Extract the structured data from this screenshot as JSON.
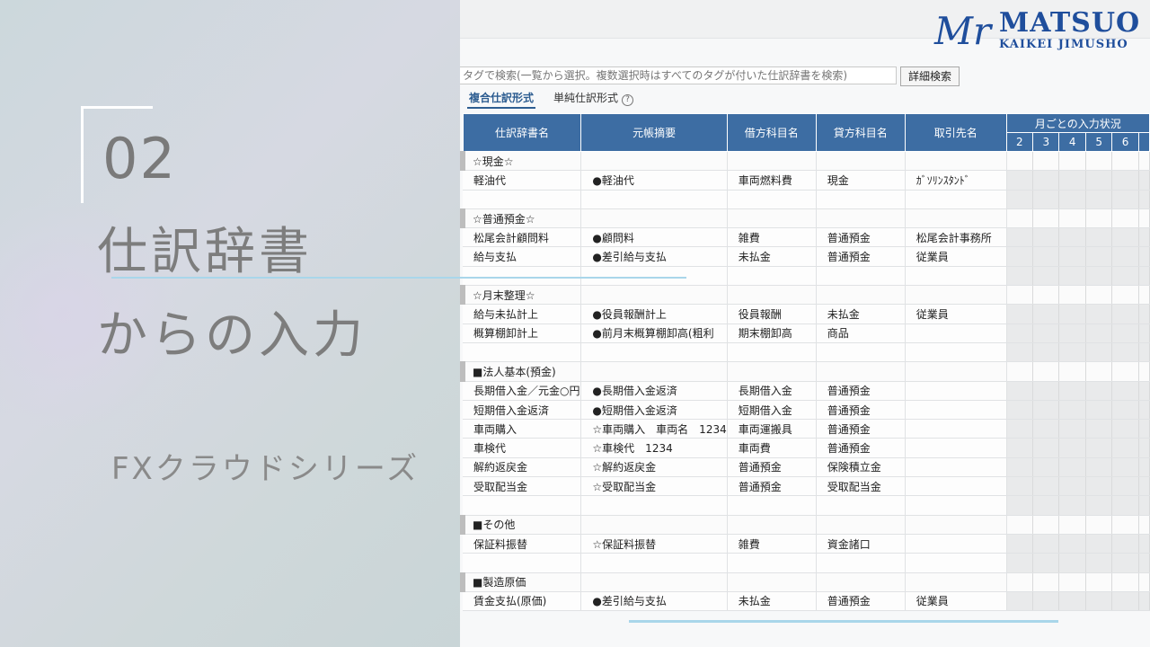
{
  "slide": {
    "number": "02",
    "title_line1": "仕訳辞書",
    "title_line2": "からの入力",
    "subtitle": "FXクラウドシリーズ"
  },
  "logo": {
    "mark": "Mr",
    "name": "MATSUO",
    "sub": "KAIKEI JIMUSHO",
    "color": "#1f4e9c"
  },
  "search": {
    "placeholder": "タグで検索(一覧から選択。複数選択時はすべてのタグが付いた仕訳辞書を検索)",
    "detail_button": "詳細検索"
  },
  "tabs": {
    "composite": "複合仕訳形式",
    "simple": "単純仕訳形式",
    "help_icon": "?"
  },
  "table": {
    "header_color": "#3d6da3",
    "columns": [
      "仕訳辞書名",
      "元帳摘要",
      "借方科目名",
      "貸方科目名",
      "取引先名"
    ],
    "monthly_header": "月ごとの入力状況",
    "months": [
      "2",
      "3",
      "4",
      "5",
      "6"
    ],
    "rows": [
      {
        "type": "category",
        "name": "☆現金☆"
      },
      {
        "name": "軽油代",
        "memo": "●軽油代",
        "debit": "車両燃料費",
        "credit": "現金",
        "partner": "ｶﾞｿﾘﾝｽﾀﾝﾄﾞ"
      },
      {
        "type": "blank"
      },
      {
        "type": "category",
        "name": "☆普通預金☆"
      },
      {
        "name": "松尾会計顧問料",
        "memo": "●顧問料",
        "debit": "雑費",
        "credit": "普通預金",
        "partner": "松尾会計事務所"
      },
      {
        "name": "給与支払",
        "memo": "●差引給与支払",
        "debit": "未払金",
        "credit": "普通預金",
        "partner": "従業員"
      },
      {
        "type": "blank"
      },
      {
        "type": "category",
        "name": "☆月末整理☆"
      },
      {
        "name": "給与未払計上",
        "memo": "●役員報酬計上",
        "debit": "役員報酬",
        "credit": "未払金",
        "partner": "従業員"
      },
      {
        "name": "概算棚卸計上",
        "memo": "●前月末概算棚卸高(粗利",
        "debit": "期末棚卸高",
        "credit": "商品",
        "partner": ""
      },
      {
        "type": "blank"
      },
      {
        "type": "category",
        "name": "■法人基本(預金)"
      },
      {
        "name": "長期借入金／元金○円",
        "memo": "●長期借入金返済",
        "debit": "長期借入金",
        "credit": "普通預金",
        "partner": ""
      },
      {
        "name": "短期借入金返済",
        "memo": "●短期借入金返済",
        "debit": "短期借入金",
        "credit": "普通預金",
        "partner": ""
      },
      {
        "name": "車両購入",
        "memo": "☆車両購入　車両名　1234",
        "debit": "車両運搬具",
        "credit": "普通預金",
        "partner": ""
      },
      {
        "name": "車検代",
        "memo": "☆車検代　1234",
        "debit": "車両費",
        "credit": "普通預金",
        "partner": ""
      },
      {
        "name": "解約返戻金",
        "memo": "☆解約返戻金",
        "debit": "普通預金",
        "credit": "保険積立金",
        "partner": ""
      },
      {
        "name": "受取配当金",
        "memo": "☆受取配当金",
        "debit": "普通預金",
        "credit": "受取配当金",
        "partner": ""
      },
      {
        "type": "blank"
      },
      {
        "type": "category",
        "name": "■その他"
      },
      {
        "name": "保証料振替",
        "memo": "☆保証料振替",
        "debit": "雑費",
        "credit": "資金諸口",
        "partner": ""
      },
      {
        "type": "blank"
      },
      {
        "type": "category",
        "name": "■製造原価"
      },
      {
        "name": "賃金支払(原価)",
        "memo": "●差引給与支払",
        "debit": "未払金",
        "credit": "普通預金",
        "partner": "従業員"
      }
    ]
  }
}
